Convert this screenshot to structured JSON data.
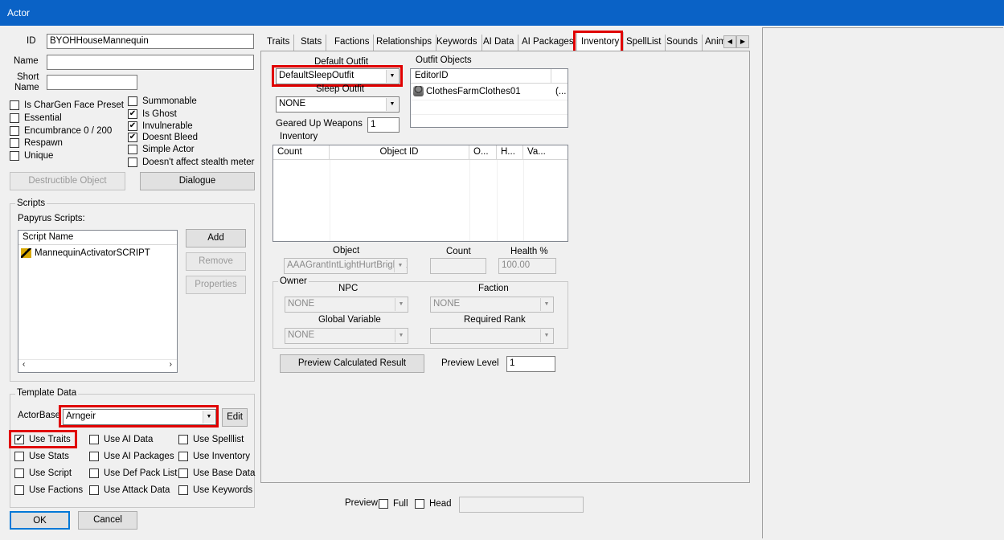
{
  "window": {
    "title": "Actor"
  },
  "left": {
    "id_label": "ID",
    "id_value": "BYOHHouseMannequin",
    "name_label": "Name",
    "name_value": "",
    "short_label_1": "Short",
    "short_label_2": "Name",
    "short_value": "",
    "flags_col1": [
      {
        "label": "Is CharGen Face Preset",
        "checked": false
      },
      {
        "label": "Essential",
        "checked": false
      },
      {
        "label": "Encumbrance 0 / 200",
        "checked": false
      },
      {
        "label": "Respawn",
        "checked": false
      },
      {
        "label": "Unique",
        "checked": false
      }
    ],
    "flags_col2": [
      {
        "label": "Summonable",
        "checked": false
      },
      {
        "label": "Is Ghost",
        "checked": true
      },
      {
        "label": "Invulnerable",
        "checked": true
      },
      {
        "label": "Doesnt Bleed",
        "checked": true
      },
      {
        "label": "Simple Actor",
        "checked": false
      },
      {
        "label": "Doesn't affect stealth meter",
        "checked": false
      }
    ],
    "destructible_button": "Destructible Object",
    "dialogue_button": "Dialogue"
  },
  "scripts": {
    "group_label": "Scripts",
    "papyrus_label": "Papyrus Scripts:",
    "column": "Script Name",
    "items": [
      "MannequinActivatorSCRIPT"
    ],
    "add_button": "Add",
    "remove_button": "Remove",
    "properties_button": "Properties"
  },
  "template": {
    "group_label": "Template Data",
    "actorbase_label": "ActorBase",
    "actorbase_value": "Arngeir",
    "edit_button": "Edit",
    "options": [
      {
        "label": "Use Traits",
        "checked": true
      },
      {
        "label": "Use AI Data",
        "checked": false
      },
      {
        "label": "Use Spelllist",
        "checked": false
      },
      {
        "label": "Use Stats",
        "checked": false
      },
      {
        "label": "Use AI Packages",
        "checked": false
      },
      {
        "label": "Use Inventory",
        "checked": false
      },
      {
        "label": "Use Script",
        "checked": false
      },
      {
        "label": "Use Def Pack List",
        "checked": false
      },
      {
        "label": "Use Base Data",
        "checked": false
      },
      {
        "label": "Use Factions",
        "checked": false
      },
      {
        "label": "Use Attack Data",
        "checked": false
      },
      {
        "label": "Use Keywords",
        "checked": false
      }
    ]
  },
  "buttons": {
    "ok": "OK",
    "cancel": "Cancel"
  },
  "tabs": [
    "Traits",
    "Stats",
    "Factions",
    "Relationships",
    "Keywords",
    "AI Data",
    "AI Packages",
    "Inventory",
    "SpellList",
    "Sounds",
    "Anim"
  ],
  "tab_arrows": {
    "left": "◀",
    "right": "▶"
  },
  "inventory": {
    "default_outfit_label": "Default Outfit",
    "default_outfit_value": "DefaultSleepOutfit",
    "sleep_outfit_label": "Sleep Outfit",
    "sleep_outfit_value": "NONE",
    "geared_label": "Geared Up Weapons",
    "geared_value": "1",
    "outfit_objects_label": "Outfit Objects",
    "outfit_columns": [
      "EditorID",
      ""
    ],
    "outfit_rows": [
      {
        "id": "ClothesFarmClothes01",
        "extra": "(..."
      }
    ],
    "inventory_label": "Inventory",
    "inv_columns": [
      "Count",
      "Object ID",
      "O...",
      "H...",
      "Va..."
    ],
    "object_label": "Object",
    "object_value": "AAAGrantIntLightHurtBrightE",
    "count_label": "Count",
    "count_value": "",
    "health_label": "Health %",
    "health_value": "100.00",
    "owner_label": "Owner",
    "npc_label": "NPC",
    "npc_value": "NONE",
    "faction_label": "Faction",
    "faction_value": "NONE",
    "global_label": "Global Variable",
    "global_value": "NONE",
    "rank_label": "Required Rank",
    "rank_value": "",
    "preview_calc_button": "Preview Calculated Result",
    "preview_level_label": "Preview Level",
    "preview_level_value": "1"
  },
  "preview": {
    "label": "Preview",
    "full_label": "Full",
    "head_label": "Head",
    "value": ""
  },
  "colors": {
    "titlebar": "#0a62c6",
    "highlight": "#e00000"
  }
}
